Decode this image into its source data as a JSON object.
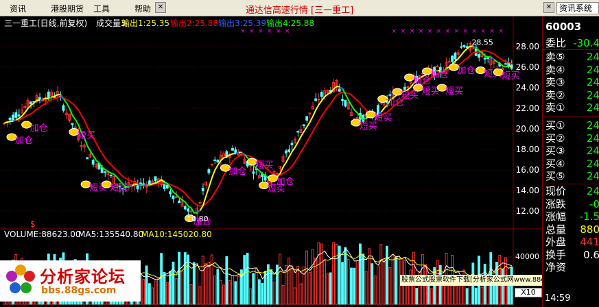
{
  "menu": {
    "items": [
      "资讯",
      "港股期货",
      "工具",
      "帮助"
    ],
    "title": "通达信高速行情 [三一重工]",
    "search_text": "资讯系统"
  },
  "chart_header": {
    "stock_label": "三一重工(日线,前复权)",
    "indicator_label": "成交量3",
    "output1": "输出1:25.35",
    "output2": "输出2:25.88",
    "output3": "输出3:25.39",
    "output4": "输出4:25.88"
  },
  "volume_header": {
    "volume": "VOLUME:88623.00",
    "ma5": "MA5:135540.80",
    "ma10": "MA10:145020.80"
  },
  "colors": {
    "up": "#ff3232",
    "down": "#54ffff",
    "line_yellow": "#ffff00",
    "line_red": "#ff0000",
    "line_green": "#00ff00",
    "line_blue": "#3060ff",
    "signal_text": "#ff00ff",
    "axis": "#800000"
  },
  "chart_data": {
    "type": "candlestick",
    "yaxis_ticks": [
      28.0,
      26.0,
      24.0,
      22.0,
      20.0,
      18.0,
      16.0,
      14.0,
      12.0
    ],
    "ylim": [
      10.6,
      29.6
    ],
    "volume_ticks": [
      "40000",
      "X10"
    ],
    "high_label": "28.55",
    "low_label": "10.80",
    "signals": [
      {
        "text": "加仓",
        "day": 3,
        "price": 19.2
      },
      {
        "text": "加仓",
        "day": 8,
        "price": 20.4
      },
      {
        "text": "短买",
        "day": 24,
        "price": 19.7
      },
      {
        "text": "短买",
        "day": 28,
        "price": 14.6
      },
      {
        "text": "短买",
        "day": 35,
        "price": 14.6
      },
      {
        "text": "加仓",
        "day": 63,
        "price": 11.3
      },
      {
        "text": "加仓",
        "day": 75,
        "price": 16.2
      },
      {
        "text": "短买",
        "day": 84,
        "price": 16.8
      },
      {
        "text": "短买",
        "day": 88,
        "price": 14.5
      },
      {
        "text": "加仓",
        "day": 91,
        "price": 15.2
      },
      {
        "text": "短买",
        "day": 119,
        "price": 20.6
      },
      {
        "text": "短买",
        "day": 124,
        "price": 21.4
      },
      {
        "text": "加仓",
        "day": 128,
        "price": 22.9
      },
      {
        "text": "短买",
        "day": 133,
        "price": 23.6
      },
      {
        "text": "加仓",
        "day": 137,
        "price": 25.0
      },
      {
        "text": "短买",
        "day": 140,
        "price": 24.0
      },
      {
        "text": "加仓",
        "day": 143,
        "price": 25.6
      },
      {
        "text": "短买",
        "day": 148,
        "price": 24.0
      },
      {
        "text": "加仓",
        "day": 152,
        "price": 26.0
      },
      {
        "text": "短买",
        "day": 161,
        "price": 25.7
      },
      {
        "text": "短买",
        "day": 167,
        "price": 25.5
      }
    ]
  },
  "panel": {
    "code": "60003",
    "ratio": {
      "label": "委比",
      "value": "-30.4"
    },
    "asks": [
      {
        "label": "卖⑤",
        "value": "24"
      },
      {
        "label": "卖④",
        "value": "24"
      },
      {
        "label": "卖③",
        "value": "24"
      },
      {
        "label": "卖②",
        "value": "24"
      },
      {
        "label": "卖①",
        "value": "24"
      }
    ],
    "bids": [
      {
        "label": "买①",
        "value": "24"
      },
      {
        "label": "买②",
        "value": "24"
      },
      {
        "label": "买③",
        "value": "24"
      },
      {
        "label": "买④",
        "value": "24"
      },
      {
        "label": "买⑤",
        "value": "24"
      }
    ],
    "stats": [
      {
        "label": "现价",
        "value": "24"
      },
      {
        "label": "涨跌",
        "value": "-0"
      },
      {
        "label": "涨幅",
        "value": "-1.5"
      },
      {
        "label": "总量",
        "value": "880"
      },
      {
        "label": "外盘",
        "value": "441"
      },
      {
        "label": "换手",
        "value": "0.6"
      },
      {
        "label": "净资",
        "value": ""
      }
    ]
  },
  "logo": {
    "name": "分析家论坛",
    "url": "bbs.88gs.com"
  },
  "ad_text": "股票公式股票软件下载[分析家公式网www.88gs.com]",
  "time": "14:59",
  "dollar_marker": "$"
}
